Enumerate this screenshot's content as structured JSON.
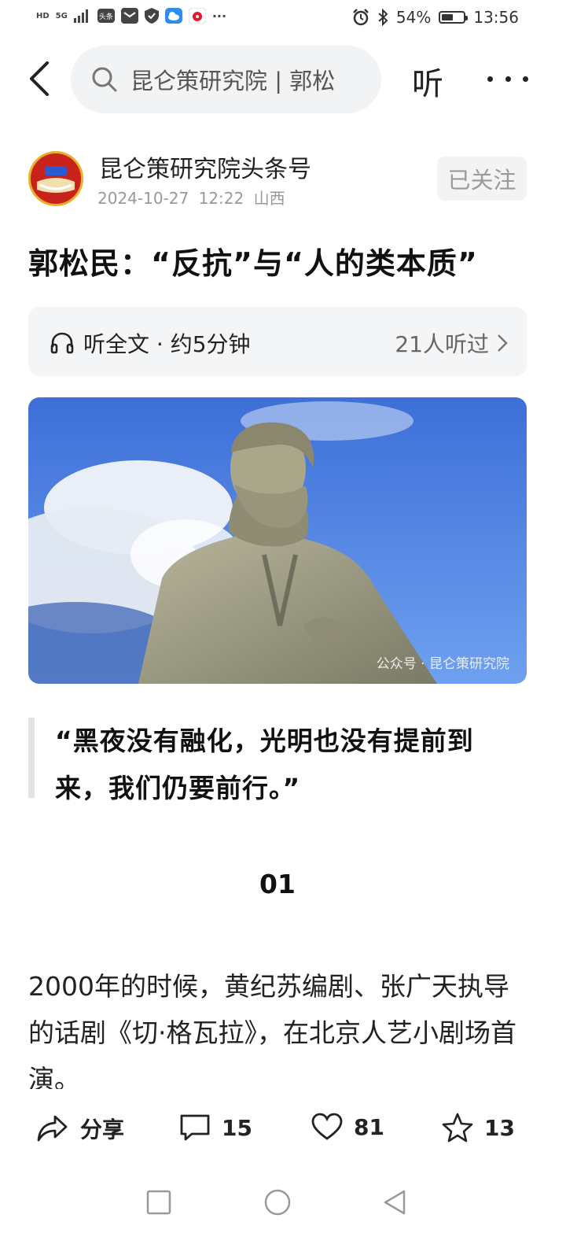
{
  "status_bar": {
    "left_icons": [
      "HD",
      "5G",
      "signal-bars-icon",
      "toutiao-app-icon",
      "mail-app-icon",
      "shield-app-icon",
      "cloud-app-icon",
      "weibo-app-icon",
      "more-notifications-icon"
    ],
    "net_label": "HD",
    "gen_label": "5G",
    "app_badge": "头条",
    "battery": "54%",
    "battery_level": 0.54,
    "time": "13:56"
  },
  "header": {
    "search_value": "昆仑策研究院 | 郭松",
    "listen_label": "听"
  },
  "author": {
    "name": "昆仑策研究院头条号",
    "date": "2024-10-27",
    "time": "12:22",
    "location": "山西",
    "follow_label": "已关注"
  },
  "article": {
    "title": "郭松民：“反抗”与“人的类本质”",
    "audio_label": "听全文 · 约5分钟",
    "listeners": "21人听过",
    "image_watermark": "公众号 · 昆仑策研究院",
    "quote": "“黑夜没有融化，光明也没有提前到来，我们仍要前行。”",
    "section_number": "01",
    "body": "2000年的时候，黄纪苏编剧、张广天执导的话剧《切·格瓦拉》，在北京人艺小剧场首演。"
  },
  "actions": {
    "share_label": "分享",
    "comments": "15",
    "likes": "81",
    "favorites": "13"
  },
  "colors": {
    "background": "#ffffff",
    "search_bg": "#f2f3f5",
    "muted_text": "#999999",
    "sky": "#4f8be8"
  }
}
